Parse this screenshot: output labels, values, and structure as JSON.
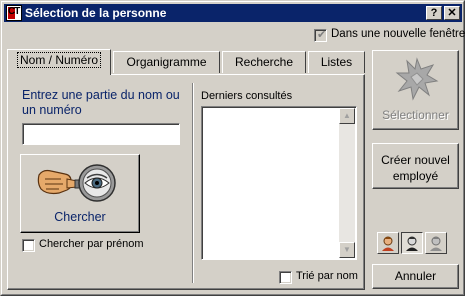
{
  "window": {
    "title": "Sélection de la personne",
    "help_label": "?",
    "close_label": "✕"
  },
  "options": {
    "new_window_label": "Dans une nouvelle fenêtre",
    "new_window_checked": true
  },
  "tabs": [
    {
      "label": "Nom / Numéro",
      "active": true
    },
    {
      "label": "Organigramme",
      "active": false
    },
    {
      "label": "Recherche",
      "active": false
    },
    {
      "label": "Listes",
      "active": false
    }
  ],
  "name_tab": {
    "prompt": "Entrez une partie du nom ou un numéro",
    "input_value": "",
    "search_button": "Chercher",
    "firstname_label": "Chercher par prénom",
    "firstname_checked": false,
    "recent_label": "Derniers consultés",
    "recent_items": [],
    "sorted_label": "Trié par nom",
    "sorted_checked": false
  },
  "actions": {
    "select_label": "Sélectionner",
    "create_label": "Créer nouvel employé",
    "cancel_label": "Annuler"
  },
  "colors": {
    "title_bar": "#0a246a",
    "face": "#d4d0c8",
    "link_text": "#0a246a",
    "disabled_text": "#808080"
  }
}
